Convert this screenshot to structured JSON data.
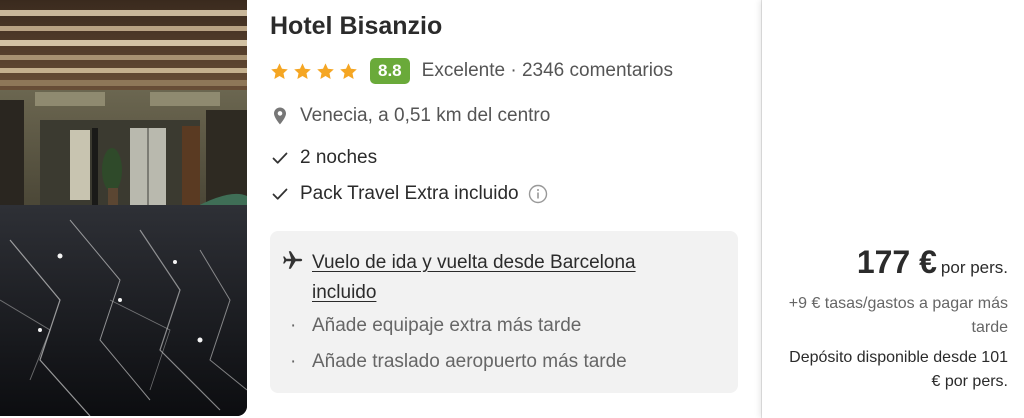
{
  "hotel": {
    "name": "Hotel Bisanzio",
    "stars": 4,
    "score": "8.8",
    "rating_label": "Excelente · 2346 comentarios",
    "location": "Venecia, a 0,51 km del centro",
    "nights": "2 noches",
    "pack": "Pack Travel Extra incluido"
  },
  "flight": {
    "link_label": "Vuelo de ida y vuelta desde Barcelona incluido",
    "extras": [
      "Añade equipaje extra más tarde",
      "Añade traslado aeropuerto más tarde"
    ]
  },
  "pricing": {
    "price": "177 €",
    "per_person": "por pers.",
    "taxes": "+9 € tasas/gastos a pagar más tarde",
    "deposit": "Depósito disponible desde 101 € por pers."
  },
  "colors": {
    "star": "#f5a623",
    "score_badge": "#6aaa3a",
    "flight_box": "#f2f2f2"
  },
  "icons": {
    "location": "map-pin-icon",
    "check": "check-icon",
    "info": "info-icon",
    "flight": "airplane-icon"
  }
}
